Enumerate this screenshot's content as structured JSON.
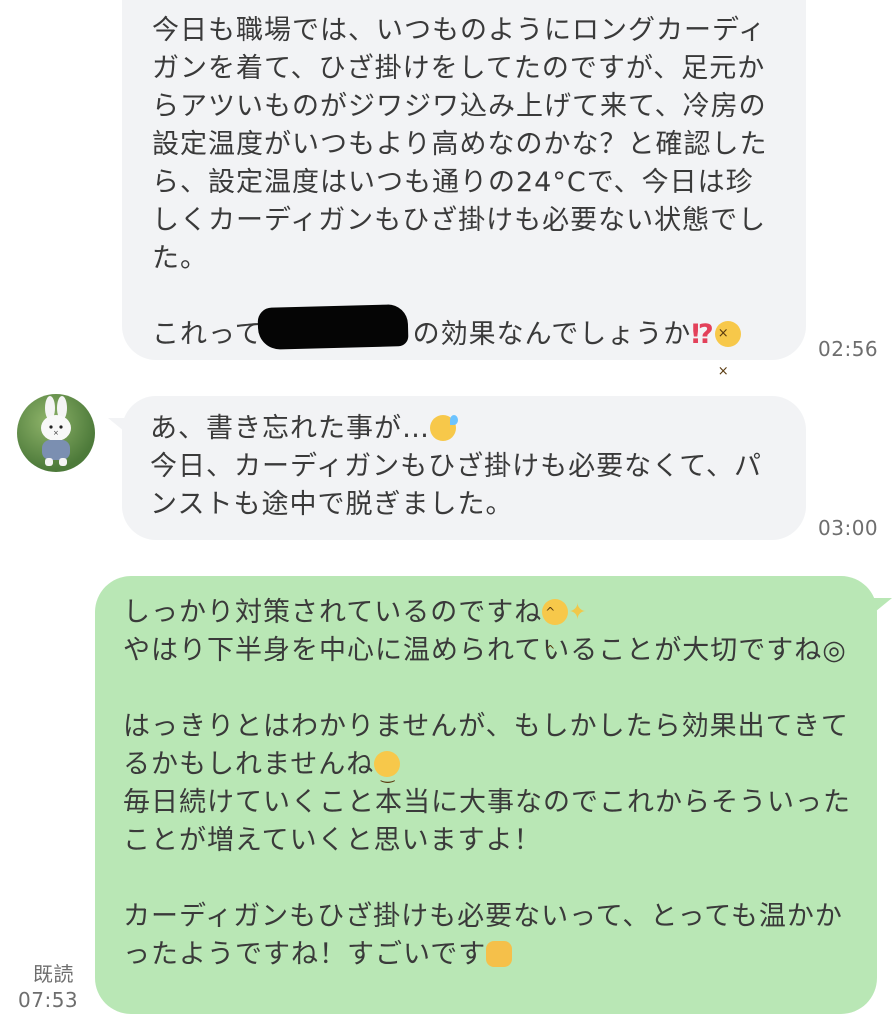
{
  "messages": [
    {
      "sender": "them",
      "part1": "今日も職場では、いつものようにロングカーディガンを着て、ひざ掛けをしてたのですが、足元からアツいものがジワジワ込み上げて来て、冷房の設定温度がいつもより高めなのかな？と確認したら、設定温度はいつも通りの24°Cで、今日は珍しくカーディガンもひざ掛けも必要ない状態でした。\n\nこれって",
      "part2": "の効果なんでしょうか",
      "exclaim": "⁉",
      "emoji_icon": "dizzy-face-icon",
      "time": "02:56"
    },
    {
      "sender": "them",
      "part1": "あ、書き忘れた事が…",
      "emoji_icon": "sweat-smile-icon",
      "part2": "\n今日、カーディガンもひざ掛けも必要なくて、パンストも途中で脱ぎました。",
      "time": "03:00"
    },
    {
      "sender": "me",
      "line1": "しっかり対策されているのですね",
      "emoji1_icon": "blush-smile-icon",
      "sparkle_icon": "sparkles-icon",
      "line2": "\nやはり下半身を中心に温められていることが大切ですね◎\n\nはっきりとはわかりませんが、もしかしたら効果出てきてるかもしれませんね",
      "emoji2_icon": "slight-smile-icon",
      "line3": "\n毎日続けていくこと本当に大事なのでこれからそういったことが増えていくと思いますよ！\n\nカーディガンもひざ掛けも必要ないって、とっても温かかったようですね！すごいです",
      "emoji3_icon": "raising-hands-icon",
      "read_label": "既読",
      "time": "07:53"
    }
  ],
  "colors": {
    "incoming_bubble": "#f2f3f5",
    "outgoing_bubble": "#b9e7b5",
    "text": "#3a3a3a",
    "timestamp": "#6e6e6e"
  }
}
